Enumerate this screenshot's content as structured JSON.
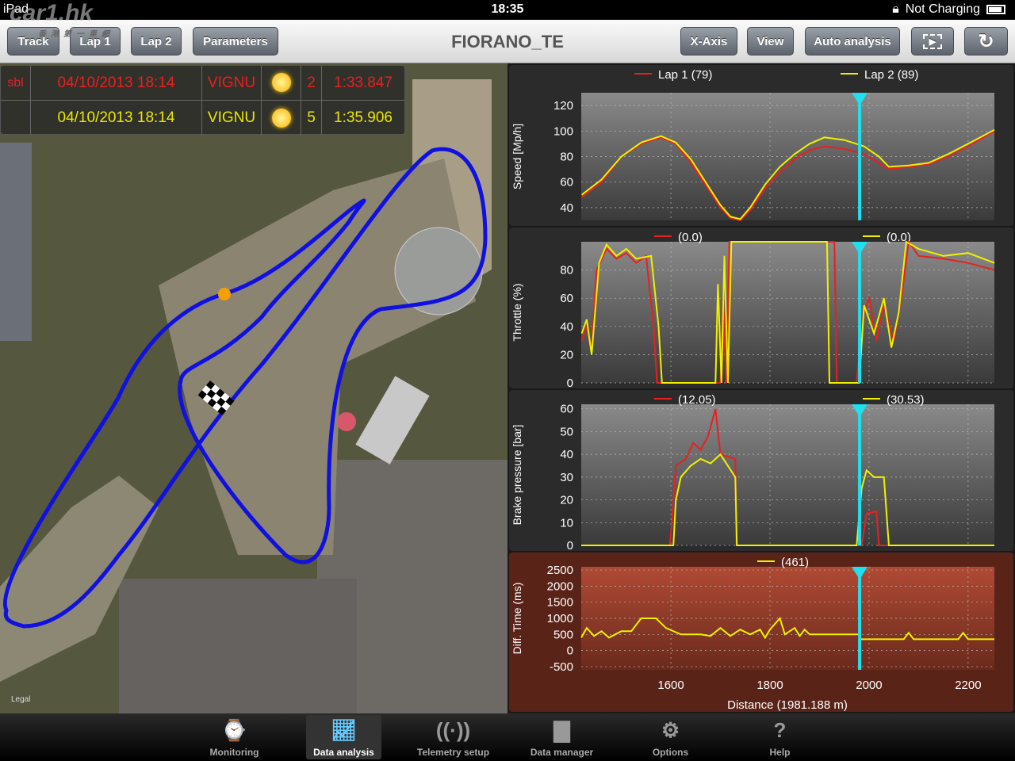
{
  "status": {
    "device": "iPad",
    "time": "18:35",
    "charging": "Not Charging"
  },
  "watermark": {
    "text": "car1.hk",
    "sub": "香港第一車網"
  },
  "toolbar": {
    "title": "FIORANO_TE",
    "left": [
      "Track",
      "Lap 1",
      "Lap 2",
      "Parameters"
    ],
    "right": [
      "X-Axis",
      "View",
      "Auto analysis"
    ],
    "icons": [
      "film-play-icon",
      "refresh-icon"
    ]
  },
  "laps": [
    {
      "tag": "sbl",
      "date": "04/10/2013 18:14",
      "driver": "VIGNU",
      "weather": "sunny",
      "lap": "2",
      "time": "1:33.847",
      "color": "#e82020"
    },
    {
      "tag": "",
      "date": "04/10/2013 18:14",
      "driver": "VIGNU",
      "weather": "sunny",
      "lap": "5",
      "time": "1:35.906",
      "color": "#e8e800"
    }
  ],
  "map": {
    "legal": "Legal"
  },
  "chart_data": [
    {
      "type": "line",
      "ylabel": "Speed [Mp/h]",
      "yticks": [
        40,
        60,
        80,
        100,
        120
      ],
      "ylim": [
        30,
        130
      ],
      "legend": [
        "Lap 1 (79)",
        "Lap 2 (89)"
      ],
      "series": [
        {
          "name": "Lap 1",
          "color": "#e82020",
          "points": [
            [
              1420,
              48
            ],
            [
              1460,
              60
            ],
            [
              1500,
              80
            ],
            [
              1540,
              90
            ],
            [
              1580,
              95
            ],
            [
              1610,
              90
            ],
            [
              1640,
              75
            ],
            [
              1670,
              58
            ],
            [
              1700,
              40
            ],
            [
              1720,
              32
            ],
            [
              1740,
              30
            ],
            [
              1760,
              38
            ],
            [
              1790,
              55
            ],
            [
              1820,
              68
            ],
            [
              1850,
              78
            ],
            [
              1880,
              85
            ],
            [
              1910,
              88
            ],
            [
              1950,
              86
            ],
            [
              1990,
              82
            ],
            [
              2020,
              75
            ],
            [
              2040,
              70
            ],
            [
              2080,
              72
            ],
            [
              2120,
              74
            ],
            [
              2160,
              80
            ],
            [
              2200,
              88
            ],
            [
              2253,
              100
            ]
          ]
        },
        {
          "name": "Lap 2",
          "color": "#f0f000",
          "points": [
            [
              1420,
              50
            ],
            [
              1460,
              62
            ],
            [
              1500,
              80
            ],
            [
              1540,
              91
            ],
            [
              1580,
              96
            ],
            [
              1610,
              91
            ],
            [
              1640,
              78
            ],
            [
              1670,
              60
            ],
            [
              1700,
              42
            ],
            [
              1720,
              33
            ],
            [
              1740,
              31
            ],
            [
              1760,
              40
            ],
            [
              1790,
              58
            ],
            [
              1820,
              72
            ],
            [
              1850,
              82
            ],
            [
              1880,
              90
            ],
            [
              1910,
              95
            ],
            [
              1950,
              93
            ],
            [
              1990,
              88
            ],
            [
              2020,
              80
            ],
            [
              2040,
              72
            ],
            [
              2080,
              73
            ],
            [
              2120,
              75
            ],
            [
              2160,
              82
            ],
            [
              2200,
              90
            ],
            [
              2253,
              101
            ]
          ]
        }
      ]
    },
    {
      "type": "line",
      "ylabel": "Throttle (%)",
      "yticks": [
        0,
        20,
        40,
        60,
        80
      ],
      "ylim": [
        0,
        100
      ],
      "legend": [
        "(0.0)",
        "(0.0)"
      ],
      "series": [
        {
          "name": "Lap 1",
          "color": "#e82020",
          "points": [
            [
              1420,
              30
            ],
            [
              1430,
              40
            ],
            [
              1440,
              25
            ],
            [
              1450,
              80
            ],
            [
              1470,
              95
            ],
            [
              1490,
              88
            ],
            [
              1510,
              92
            ],
            [
              1530,
              85
            ],
            [
              1550,
              90
            ],
            [
              1565,
              40
            ],
            [
              1572,
              0
            ],
            [
              1700,
              0
            ],
            [
              1705,
              60
            ],
            [
              1712,
              0
            ],
            [
              1718,
              100
            ],
            [
              1725,
              100
            ],
            [
              1800,
              100
            ],
            [
              1930,
              100
            ],
            [
              1935,
              0
            ],
            [
              1975,
              0
            ],
            [
              1985,
              45
            ],
            [
              2000,
              60
            ],
            [
              2015,
              30
            ],
            [
              2030,
              55
            ],
            [
              2050,
              30
            ],
            [
              2065,
              60
            ],
            [
              2080,
              100
            ],
            [
              2100,
              90
            ],
            [
              2150,
              88
            ],
            [
              2200,
              85
            ],
            [
              2253,
              80
            ]
          ]
        },
        {
          "name": "Lap 2",
          "color": "#f0f000",
          "points": [
            [
              1420,
              35
            ],
            [
              1430,
              45
            ],
            [
              1440,
              20
            ],
            [
              1455,
              85
            ],
            [
              1470,
              98
            ],
            [
              1490,
              90
            ],
            [
              1510,
              95
            ],
            [
              1530,
              88
            ],
            [
              1560,
              90
            ],
            [
              1575,
              40
            ],
            [
              1582,
              0
            ],
            [
              1690,
              0
            ],
            [
              1695,
              70
            ],
            [
              1702,
              0
            ],
            [
              1708,
              90
            ],
            [
              1715,
              0
            ],
            [
              1722,
              100
            ],
            [
              1800,
              100
            ],
            [
              1915,
              100
            ],
            [
              1920,
              0
            ],
            [
              1980,
              0
            ],
            [
              1990,
              55
            ],
            [
              2010,
              35
            ],
            [
              2030,
              60
            ],
            [
              2045,
              25
            ],
            [
              2060,
              50
            ],
            [
              2075,
              100
            ],
            [
              2100,
              95
            ],
            [
              2150,
              90
            ],
            [
              2200,
              92
            ],
            [
              2253,
              85
            ]
          ]
        }
      ]
    },
    {
      "type": "line",
      "ylabel": "Brake pressure [bar]",
      "yticks": [
        0,
        10,
        20,
        30,
        40,
        50,
        60
      ],
      "ylim": [
        0,
        62
      ],
      "legend": [
        "(12.05)",
        "(30.53)"
      ],
      "series": [
        {
          "name": "Lap 1",
          "color": "#e82020",
          "points": [
            [
              1419,
              0
            ],
            [
              1598,
              0
            ],
            [
              1602,
              10
            ],
            [
              1610,
              35
            ],
            [
              1630,
              38
            ],
            [
              1645,
              45
            ],
            [
              1660,
              42
            ],
            [
              1675,
              48
            ],
            [
              1690,
              60
            ],
            [
              1700,
              40
            ],
            [
              1730,
              38
            ],
            [
              1732,
              0
            ],
            [
              1985,
              0
            ],
            [
              1995,
              14
            ],
            [
              2015,
              15
            ],
            [
              2020,
              0
            ],
            [
              2253,
              0
            ]
          ]
        },
        {
          "name": "Lap 2",
          "color": "#f0f000",
          "points": [
            [
              1419,
              0
            ],
            [
              1605,
              0
            ],
            [
              1610,
              20
            ],
            [
              1620,
              30
            ],
            [
              1640,
              35
            ],
            [
              1660,
              38
            ],
            [
              1680,
              36
            ],
            [
              1700,
              40
            ],
            [
              1730,
              30
            ],
            [
              1733,
              0
            ],
            [
              1975,
              0
            ],
            [
              1985,
              25
            ],
            [
              1995,
              33
            ],
            [
              2010,
              30
            ],
            [
              2030,
              30
            ],
            [
              2040,
              0
            ],
            [
              2253,
              0
            ]
          ]
        }
      ]
    },
    {
      "type": "line",
      "ylabel": "Diff. Time (ms)",
      "yticks": [
        -500,
        0,
        500,
        1000,
        1500,
        2000,
        2500
      ],
      "ylim": [
        -600,
        2600
      ],
      "legend": [
        "(461)"
      ],
      "xlabel": "Distance (1981.188 m)",
      "xticks": [
        1600,
        1800,
        2000,
        2200
      ],
      "xlim": [
        1419,
        2253
      ],
      "cursor": 1981,
      "series": [
        {
          "name": "Diff",
          "color": "#f0f000",
          "points": [
            [
              1419,
              400
            ],
            [
              1430,
              700
            ],
            [
              1445,
              450
            ],
            [
              1460,
              600
            ],
            [
              1475,
              400
            ],
            [
              1500,
              600
            ],
            [
              1520,
              600
            ],
            [
              1540,
              1000
            ],
            [
              1570,
              1000
            ],
            [
              1590,
              700
            ],
            [
              1620,
              500
            ],
            [
              1660,
              500
            ],
            [
              1680,
              450
            ],
            [
              1700,
              700
            ],
            [
              1720,
              450
            ],
            [
              1740,
              650
            ],
            [
              1760,
              500
            ],
            [
              1780,
              650
            ],
            [
              1790,
              400
            ],
            [
              1800,
              650
            ],
            [
              1820,
              1000
            ],
            [
              1830,
              500
            ],
            [
              1850,
              700
            ],
            [
              1860,
              450
            ],
            [
              1870,
              650
            ],
            [
              1880,
              500
            ],
            [
              1930,
              500
            ],
            [
              1981,
              500
            ],
            [
              1982,
              350
            ],
            [
              2070,
              350
            ],
            [
              2080,
              550
            ],
            [
              2090,
              350
            ],
            [
              2180,
              350
            ],
            [
              2190,
              550
            ],
            [
              2200,
              350
            ],
            [
              2253,
              350
            ]
          ]
        }
      ]
    }
  ],
  "tabs": [
    "Monitoring",
    "Data analysis",
    "Telemetry setup",
    "Data manager",
    "Options",
    "Help"
  ]
}
